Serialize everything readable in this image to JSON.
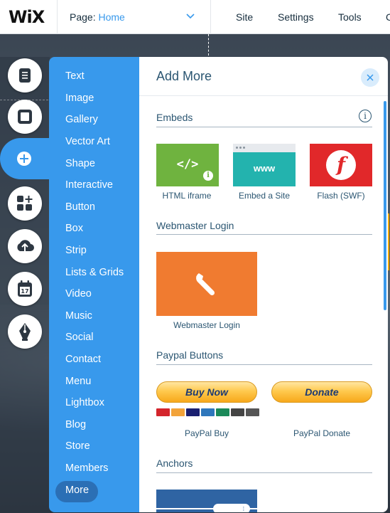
{
  "topbar": {
    "logo": "WiX",
    "page_label": "Page:",
    "page_name": "Home",
    "nav": [
      "Site",
      "Settings",
      "Tools",
      "C"
    ]
  },
  "rail": {
    "buttons": [
      "pages-icon",
      "background-icon",
      "add-icon",
      "app-market-icon",
      "upload-icon",
      "bookings-icon",
      "pen-icon"
    ]
  },
  "categories": [
    "Text",
    "Image",
    "Gallery",
    "Vector Art",
    "Shape",
    "Interactive",
    "Button",
    "Box",
    "Strip",
    "Lists & Grids",
    "Video",
    "Music",
    "Social",
    "Contact",
    "Menu",
    "Lightbox",
    "Blog",
    "Store",
    "Members"
  ],
  "more_label": "More",
  "panel": {
    "title": "Add More",
    "embeds": {
      "title": "Embeds",
      "info_glyph": "i",
      "items": [
        {
          "label": "HTML iframe",
          "glyph": "</>",
          "color": "#6fb33f"
        },
        {
          "label": "Embed a Site",
          "glyph": "www",
          "color": "#23b3ae"
        },
        {
          "label": "Flash (SWF)",
          "glyph": "f",
          "color": "#e1282a"
        }
      ]
    },
    "webmaster": {
      "title": "Webmaster Login",
      "item_label": "Webmaster Login",
      "color": "#f07b30"
    },
    "paypal": {
      "title": "Paypal Buttons",
      "buy_text": "Buy Now",
      "donate_text": "Donate",
      "buy_label": "PayPal Buy",
      "donate_label": "PayPal Donate"
    },
    "anchors": {
      "title": "Anchors"
    }
  },
  "colors": {
    "accent": "#3899ec",
    "text_dark": "#2b5672"
  }
}
